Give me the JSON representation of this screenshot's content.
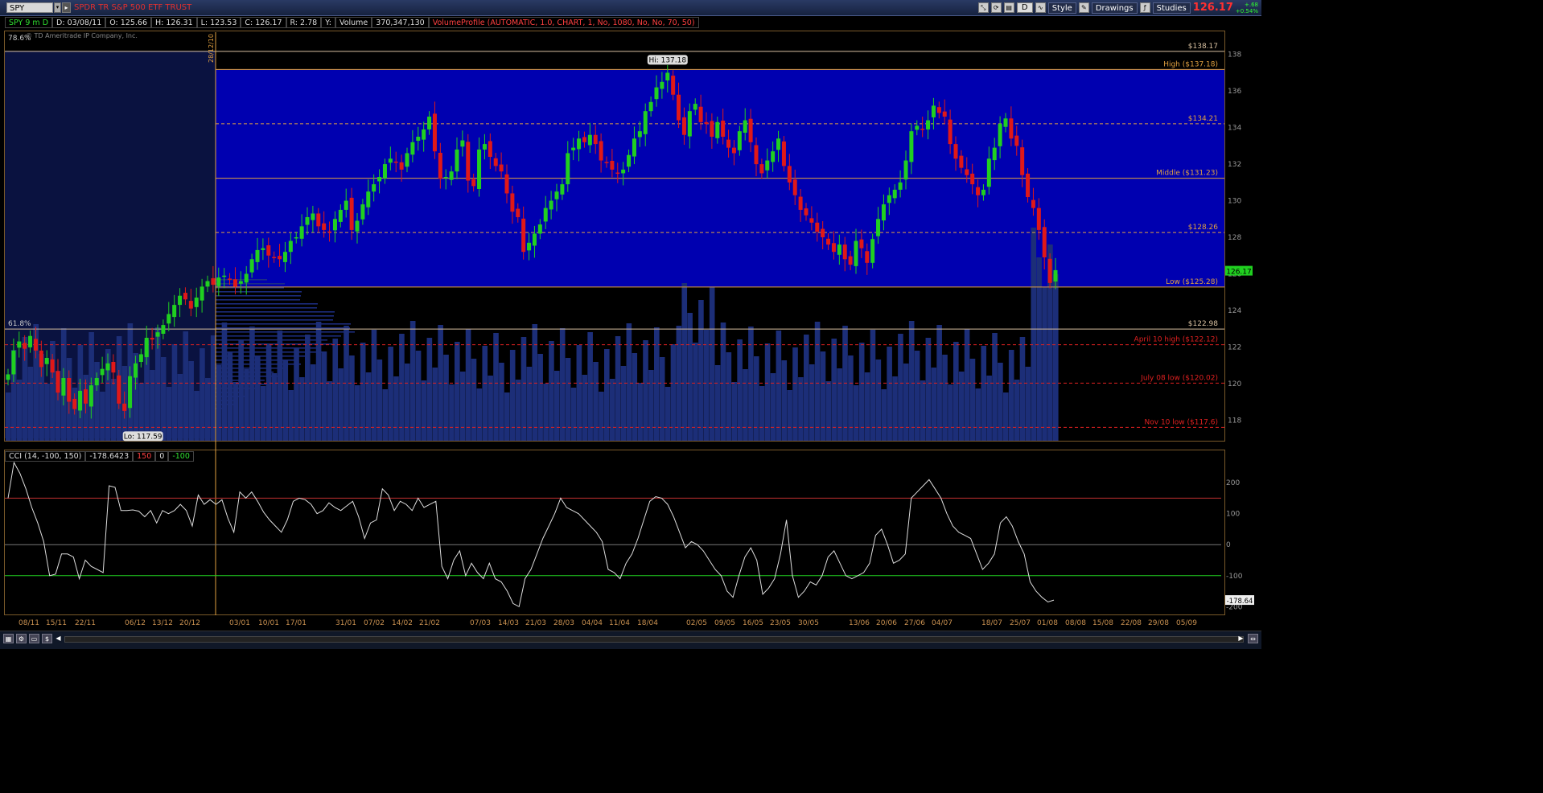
{
  "toolbar": {
    "symbol": "SPY",
    "description": "SPDR TR S&P 500 ETF TRUST",
    "period": "D",
    "style_label": "Style",
    "drawings_label": "Drawings",
    "studies_label": "Studies",
    "last_price": "126.17",
    "change": "+.68",
    "change_pct": "+0.54%"
  },
  "info": {
    "symbol_period": "SPY 9 m D",
    "date": "D: 03/08/11",
    "open": "O: 125.66",
    "high": "H: 126.31",
    "low": "L: 123.53",
    "close": "C: 126.17",
    "range": "R: 2.78",
    "y": "Y:",
    "volume_label": "Volume",
    "volume_value": "370,347,130",
    "volume_profile": "VolumeProfile (AUTOMATIC, 1.0, CHART, 1, No, 1080, No, No, 70, 50)"
  },
  "copyright": "© TD Ameritrade IP Company, Inc.",
  "colors": {
    "up": "#20d020",
    "down": "#e01818",
    "panel": "#0000b0",
    "profile": "#1c2e78",
    "gold": "#e0a040",
    "red_level": "#e02020",
    "green_level": "#20d020"
  },
  "chart_data": [
    {
      "type": "candlestick",
      "title": "SPY 9 m D",
      "ylim": [
        117,
        139
      ],
      "y_ticks": [
        118,
        120,
        122,
        124,
        126,
        128,
        130,
        132,
        134,
        136,
        138
      ],
      "x_tick_labels": [
        "08/11",
        "15/11",
        "22/11",
        "06/12",
        "13/12",
        "20/12",
        "03/01",
        "10/01",
        "17/01",
        "31/01",
        "07/02",
        "14/02",
        "21/02",
        "07/03",
        "14/03",
        "21/03",
        "28/03",
        "04/04",
        "11/04",
        "18/04",
        "02/05",
        "09/05",
        "16/05",
        "23/05",
        "30/05",
        "13/06",
        "20/06",
        "27/06",
        "04/07",
        "18/07",
        "25/07",
        "01/08",
        "08/08",
        "15/08",
        "22/08",
        "29/08",
        "05/09"
      ],
      "vertical_marker_label": "28/12/10",
      "hi_label": "Hi: 137.18",
      "lo_label": "Lo: 117.59",
      "pct_labels": [
        "78.6%",
        "61.8%"
      ],
      "levels": [
        {
          "label": "$138.17",
          "value": 138.17,
          "kind": "fib"
        },
        {
          "label": "High ($137.18)",
          "value": 137.18,
          "kind": "range"
        },
        {
          "label": "$134.21",
          "value": 134.21,
          "kind": "dashed"
        },
        {
          "label": "Middle ($131.23)",
          "value": 131.23,
          "kind": "range"
        },
        {
          "label": "$128.26",
          "value": 128.26,
          "kind": "dashed"
        },
        {
          "label": "Low ($125.28)",
          "value": 125.28,
          "kind": "range"
        },
        {
          "label": "$122.98",
          "value": 122.98,
          "kind": "fib"
        },
        {
          "label": "April 10 high ($122.12)",
          "value": 122.12,
          "kind": "red"
        },
        {
          "label": "July 08 low ($120.02)",
          "value": 120.02,
          "kind": "red"
        },
        {
          "label": "Nov 10 low ($117.6)",
          "value": 117.6,
          "kind": "red"
        }
      ],
      "closes": [
        120.5,
        121.8,
        122.3,
        121.9,
        122.6,
        121.8,
        120.9,
        121.4,
        120.6,
        119.5,
        120.3,
        119.0,
        118.6,
        119.6,
        118.9,
        119.9,
        120.3,
        120.8,
        121.1,
        120.6,
        118.9,
        118.5,
        120.4,
        121.1,
        121.6,
        122.5,
        122.4,
        122.8,
        123.2,
        123.8,
        124.3,
        124.8,
        124.6,
        124.1,
        124.7,
        125.3,
        125.6,
        125.4,
        125.8,
        125.9,
        125.7,
        125.3,
        125.6,
        126.0,
        126.8,
        127.3,
        127.4,
        127.0,
        126.9,
        126.8,
        127.2,
        127.8,
        128.0,
        128.6,
        129.1,
        129.3,
        128.6,
        128.4,
        128.3,
        129.0,
        129.5,
        130.0,
        128.4,
        128.9,
        129.8,
        130.5,
        130.9,
        131.3,
        132.0,
        132.3,
        132.1,
        131.7,
        132.6,
        133.2,
        133.5,
        133.9,
        134.6,
        132.7,
        131.2,
        131.3,
        131.6,
        132.8,
        133.3,
        131.1,
        130.8,
        132.8,
        133.1,
        132.4,
        131.9,
        131.6,
        130.4,
        129.4,
        129.1,
        127.2,
        127.7,
        128.2,
        128.7,
        129.6,
        130.0,
        130.5,
        130.9,
        132.6,
        132.9,
        133.4,
        133.2,
        133.6,
        133.1,
        132.2,
        132.1,
        131.7,
        131.5,
        131.7,
        132.5,
        133.4,
        133.8,
        134.9,
        135.4,
        136.2,
        136.5,
        137.0,
        135.8,
        134.4,
        133.6,
        134.9,
        135.3,
        134.3,
        134.2,
        133.5,
        134.3,
        133.5,
        132.9,
        132.6,
        133.8,
        134.4,
        133.2,
        132.0,
        131.5,
        132.2,
        132.7,
        133.4,
        131.9,
        131.0,
        130.3,
        129.5,
        129.2,
        128.8,
        128.3,
        128.0,
        127.6,
        127.2,
        127.6,
        126.8,
        126.5,
        127.8,
        127.4,
        126.6,
        127.9,
        129.0,
        129.8,
        130.3,
        130.6,
        131.0,
        132.2,
        133.8,
        134.1,
        133.9,
        134.4,
        135.2,
        134.8,
        134.6,
        133.1,
        132.3,
        131.8,
        131.4,
        130.9,
        130.3,
        130.6,
        132.3,
        132.9,
        134.2,
        134.5,
        133.4,
        133.0,
        131.4,
        130.2,
        129.6,
        128.4,
        126.9,
        125.5,
        126.2
      ],
      "volume_profile_note": "horizontal volume histogram on price axis"
    },
    {
      "type": "line",
      "title": "CCI (14, -100, 150)",
      "value_label": "-178.6423",
      "overbought_label": "150",
      "zero_label": "0",
      "oversold_label": "-100",
      "ylim": [
        -220,
        260
      ],
      "y_ticks": [
        -200,
        -100,
        0,
        100,
        200
      ],
      "last_label": "-178.64",
      "values": [
        150,
        265,
        230,
        180,
        120,
        70,
        10,
        -100,
        -95,
        -30,
        -30,
        -40,
        -110,
        -50,
        -70,
        -80,
        -90,
        190,
        185,
        110,
        110,
        112,
        108,
        90,
        110,
        70,
        110,
        100,
        110,
        130,
        110,
        60,
        160,
        130,
        145,
        130,
        145,
        85,
        40,
        170,
        150,
        170,
        140,
        105,
        80,
        60,
        40,
        80,
        140,
        150,
        145,
        130,
        100,
        110,
        135,
        120,
        110,
        125,
        140,
        90,
        20,
        70,
        80,
        180,
        160,
        110,
        140,
        130,
        110,
        150,
        120,
        130,
        140,
        -70,
        -110,
        -50,
        -20,
        -100,
        -60,
        -90,
        -110,
        -60,
        -110,
        -120,
        -150,
        -190,
        -200,
        -110,
        -80,
        -30,
        20,
        60,
        100,
        150,
        120,
        110,
        100,
        80,
        60,
        40,
        10,
        -80,
        -90,
        -110,
        -60,
        -30,
        20,
        80,
        140,
        155,
        150,
        130,
        90,
        40,
        -10,
        10,
        0,
        -20,
        -50,
        -80,
        -100,
        -150,
        -170,
        -100,
        -40,
        -10,
        -50,
        -160,
        -140,
        -110,
        -30,
        80,
        -100,
        -170,
        -150,
        -120,
        -130,
        -100,
        -40,
        -20,
        -60,
        -100,
        -110,
        -100,
        -90,
        -60,
        30,
        50,
        0,
        -60,
        -50,
        -30,
        150,
        170,
        190,
        210,
        180,
        150,
        100,
        60,
        40,
        30,
        20,
        -30,
        -80,
        -60,
        -30,
        70,
        90,
        60,
        10,
        -30,
        -120,
        -150,
        -170,
        -185,
        -178.64
      ]
    }
  ]
}
